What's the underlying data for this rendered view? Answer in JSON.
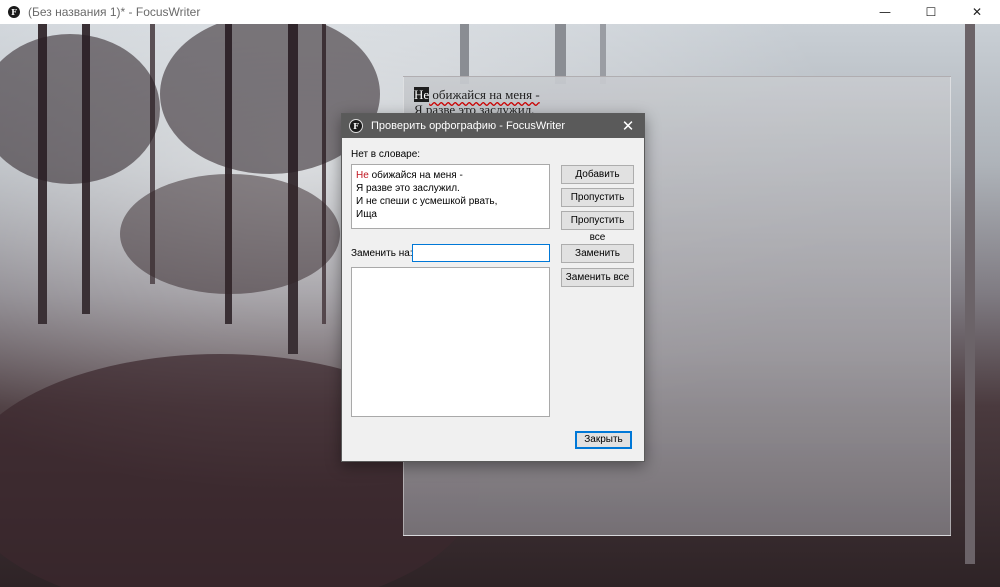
{
  "window": {
    "title": "(Без названия 1)* - FocusWriter",
    "icon_letter": "F",
    "minimize_symbol": "—",
    "maximize_symbol": "☐",
    "close_symbol": "✕"
  },
  "editor": {
    "line1_highlight": "Не",
    "line1_rest": " обижайся на меня -",
    "line2_word1": "Я",
    "line2_sp1": " ",
    "line2_word2": "разве",
    "line2_sp2": " ",
    "line2_word3": "это",
    "line2_sp3": " ",
    "line2_word4": "заслужил."
  },
  "dialog": {
    "title": "Проверить орфографию - FocusWriter",
    "icon_letter": "F",
    "close_symbol": "✕",
    "not_in_dictionary_label": "Нет в словаре:",
    "context": {
      "misspelled_word": "Не",
      "line1_rest": " обижайся на меня -",
      "line2": "Я разве это заслужил.",
      "line3": "И не спеши с усмешкой рвать,",
      "line4": "Ища"
    },
    "replace_with_label": "Заменить на:",
    "replace_with_value": "",
    "suggestions": [],
    "buttons": {
      "add": "Добавить",
      "skip": "Пропустить",
      "skip_all": "Пропустить все",
      "replace": "Заменить",
      "replace_all": "Заменить все",
      "close": "Закрыть"
    }
  }
}
